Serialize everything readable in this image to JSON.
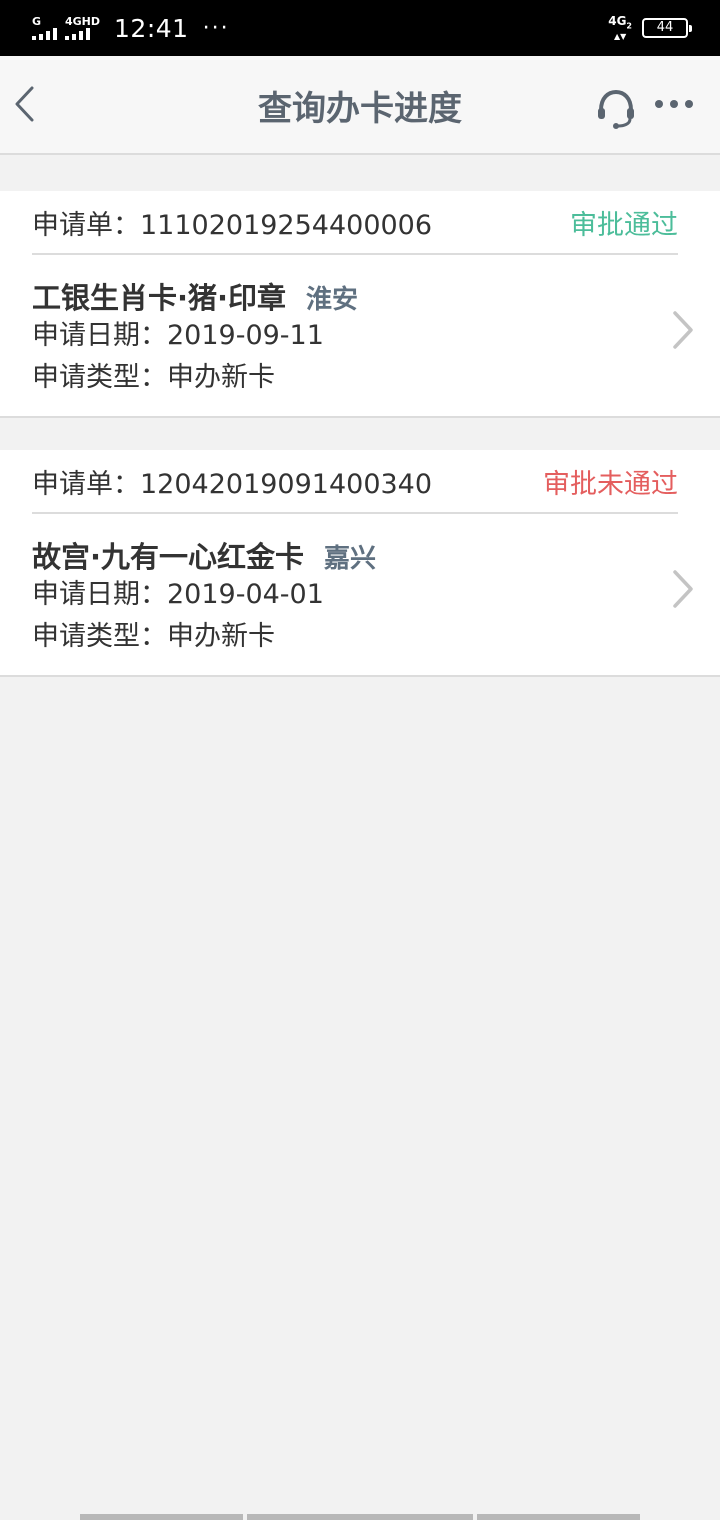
{
  "status_bar": {
    "sim1_label": "G",
    "sim2_label": "4GHD",
    "time": "12:41",
    "more": "···",
    "network": "4G",
    "network_sub": "2",
    "battery": "44"
  },
  "nav": {
    "title": "查询办卡进度",
    "back_icon": "chevron-left-icon",
    "service_icon": "headset-icon",
    "more_icon": "more-horizontal-icon"
  },
  "applications": [
    {
      "order_label": "申请单：",
      "order_no": "11102019254400006",
      "status": "审批通过",
      "status_color": "#4cbd9a",
      "card_name": "工银生肖卡·猪·印章",
      "city": "淮安",
      "date_label": "申请日期：",
      "date": "2019-09-11",
      "type_label": "申请类型：",
      "type": "申办新卡"
    },
    {
      "order_label": "申请单：",
      "order_no": "12042019091400340",
      "status": "审批未通过",
      "status_color": "#e45e5e",
      "card_name": "故宫·九有一心红金卡",
      "city": "嘉兴",
      "date_label": "申请日期：",
      "date": "2019-04-01",
      "type_label": "申请类型：",
      "type": "申办新卡"
    }
  ],
  "colors": {
    "approved": "#4cbd9a",
    "rejected": "#e45e5e",
    "title": "#5b6570",
    "background": "#f2f2f2"
  }
}
